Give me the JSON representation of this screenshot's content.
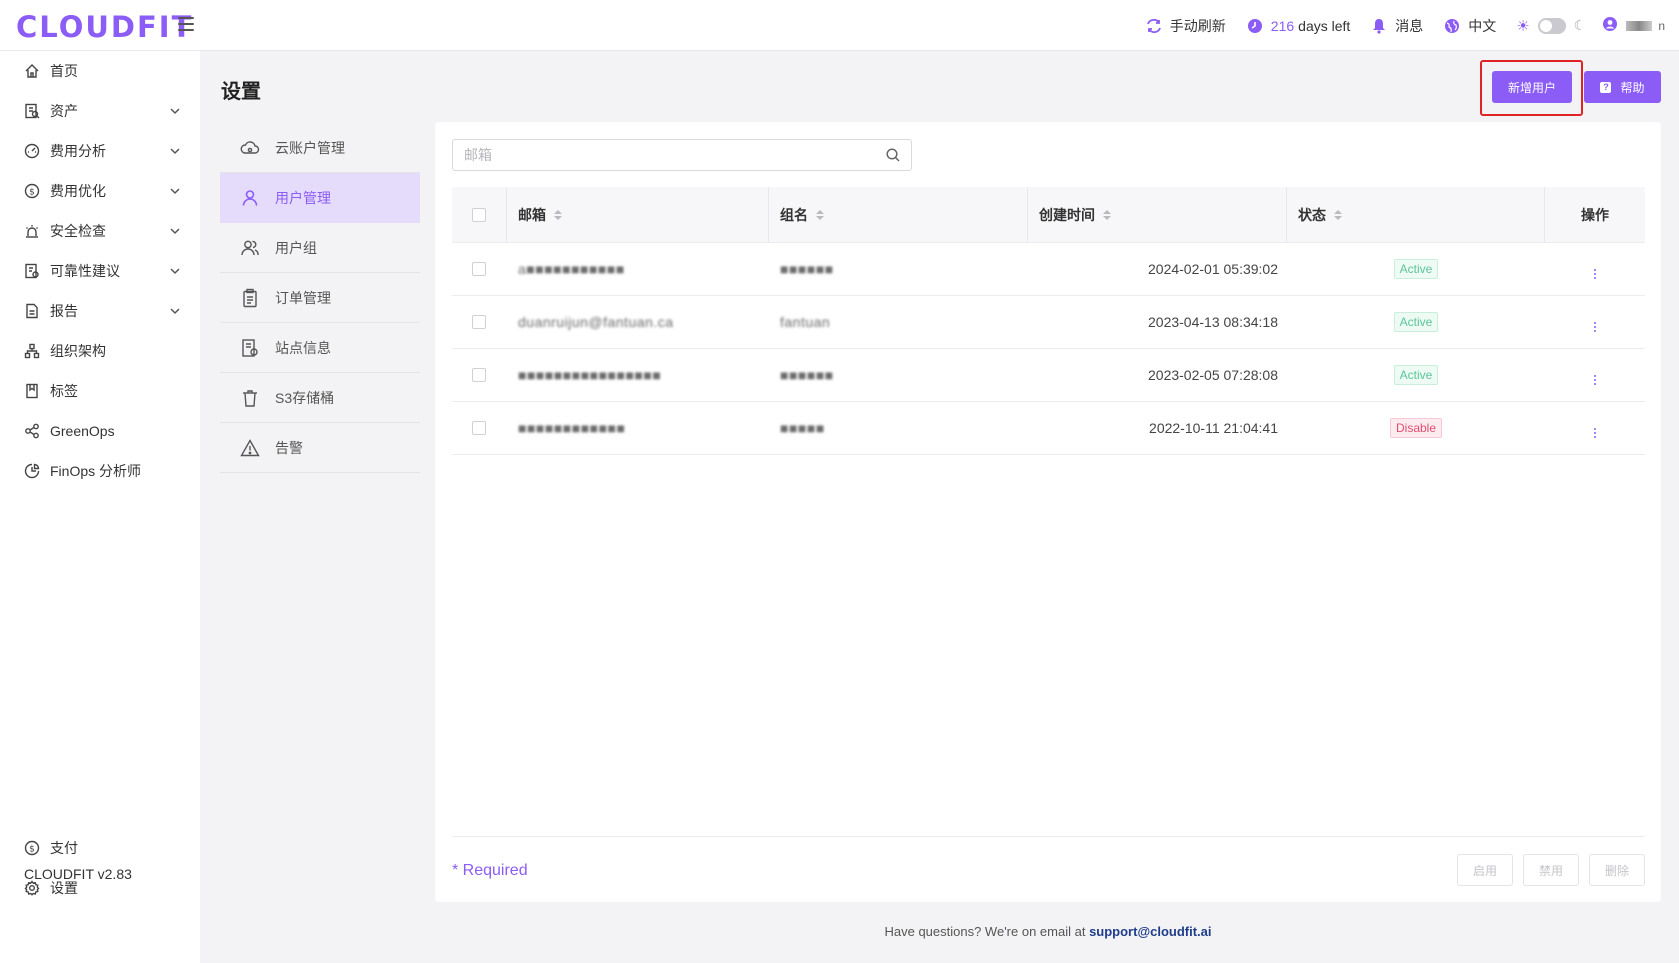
{
  "header": {
    "logo": "CLOUDFIT",
    "refresh_label": "手动刷新",
    "days_num": "216",
    "days_text": "days left",
    "messages_label": "消息",
    "language_label": "中文"
  },
  "sidebar": {
    "items": [
      {
        "label": "首页"
      },
      {
        "label": "资产"
      },
      {
        "label": "费用分析"
      },
      {
        "label": "费用优化"
      },
      {
        "label": "安全检查"
      },
      {
        "label": "可靠性建议"
      },
      {
        "label": "报告"
      },
      {
        "label": "组织架构"
      },
      {
        "label": "标签"
      },
      {
        "label": "GreenOps"
      },
      {
        "label": "FinOps 分析师"
      }
    ],
    "bottom": [
      {
        "label": "支付"
      },
      {
        "label": "设置"
      }
    ],
    "version": "CLOUDFIT v2.83"
  },
  "settings": {
    "title": "设置",
    "submenu": [
      {
        "label": "云账户管理"
      },
      {
        "label": "用户管理"
      },
      {
        "label": "用户组"
      },
      {
        "label": "订单管理"
      },
      {
        "label": "站点信息"
      },
      {
        "label": "S3存储桶"
      },
      {
        "label": "告警"
      }
    ]
  },
  "buttons": {
    "add_user": "新增用户",
    "help": "帮助"
  },
  "search": {
    "placeholder": "邮箱"
  },
  "table": {
    "headers": [
      "邮箱",
      "组名",
      "创建时间",
      "状态",
      "操作"
    ],
    "rows": [
      {
        "email": "a■■■■■■■■■■■",
        "group": "■■■■■■",
        "created": "2024-02-01 05:39:02",
        "status": "Active"
      },
      {
        "email": "duanruijun@fantuan.ca",
        "group": "fantuan",
        "created": "2023-04-13 08:34:18",
        "status": "Active"
      },
      {
        "email": "■■■■■■■■■■■■■■■■",
        "group": "■■■■■■",
        "created": "2023-02-05 07:28:08",
        "status": "Active"
      },
      {
        "email": "■■■■■■■■■■■■",
        "group": "■■■■■",
        "created": "2022-10-11 21:04:41",
        "status": "Disable"
      }
    ]
  },
  "footer": {
    "required": "* Required",
    "enable": "启用",
    "disable": "禁用",
    "delete": "删除"
  },
  "bottom_note": {
    "text": "Have questions? We're on email at ",
    "email": "support@cloudfit.ai"
  },
  "colors": {
    "accent": "#8b5cf6",
    "active": "#5bc59a",
    "disable": "#e04d72",
    "highlight_box": "#e02424"
  }
}
